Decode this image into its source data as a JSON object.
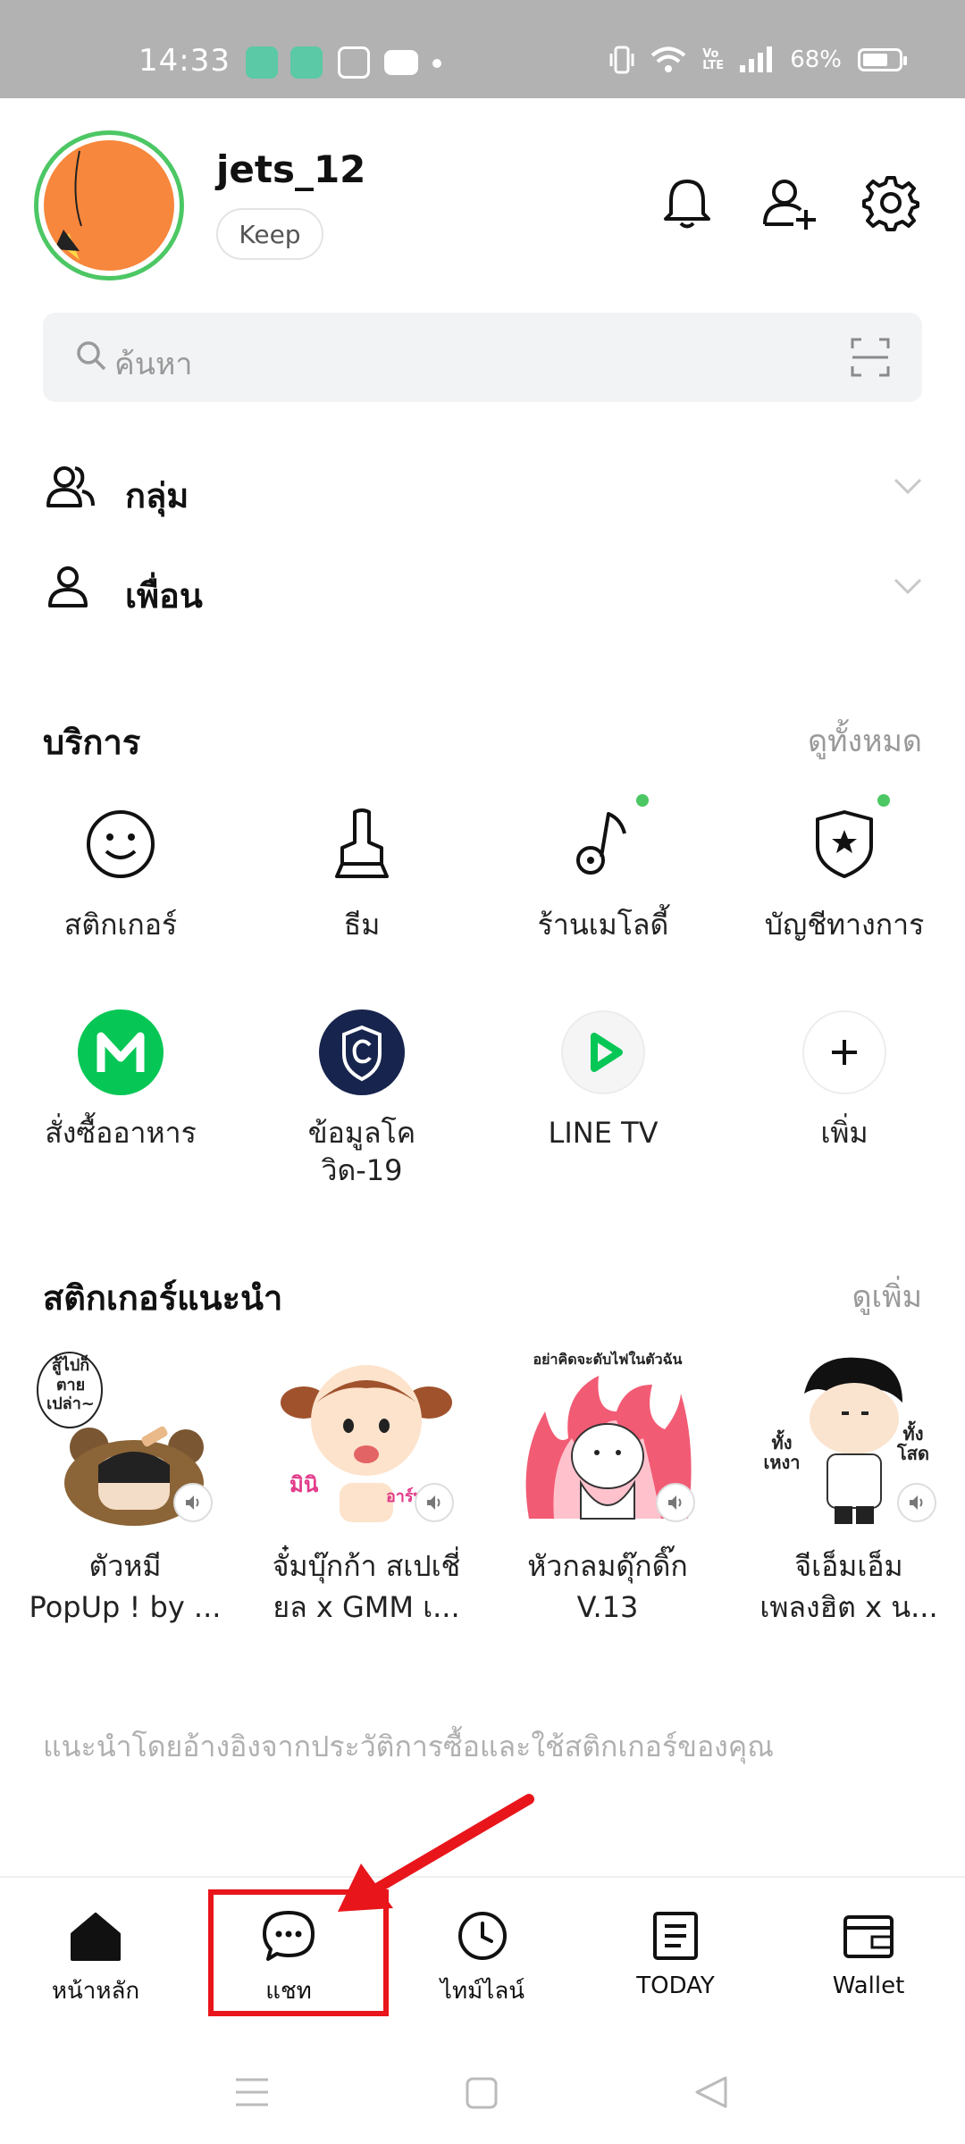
{
  "status_bar": {
    "time": "14:33",
    "battery": "68%",
    "network_badge": "Vo LTE"
  },
  "profile": {
    "name": "jets_12",
    "keep_label": "Keep"
  },
  "search": {
    "placeholder": "ค้นหา"
  },
  "lists": {
    "groups_label": "กลุ่ม",
    "friends_label": "เพื่อน"
  },
  "services": {
    "title": "บริการ",
    "see_all": "ดูทั้งหมด",
    "items": [
      {
        "label": "สติกเกอร์",
        "icon": "sticker-smile-icon"
      },
      {
        "label": "ธีม",
        "icon": "theme-brush-icon"
      },
      {
        "label": "ร้านเมโลดี้",
        "icon": "melody-note-icon"
      },
      {
        "label": "บัญชีทางการ",
        "icon": "official-shield-icon"
      },
      {
        "label": "สั่งซื้ออาหาร",
        "icon": "lineman-icon"
      },
      {
        "label": "ข้อมูลโควิด-19",
        "icon": "covid-shield-icon"
      },
      {
        "label": "LINE TV",
        "icon": "play-icon"
      },
      {
        "label": "เพิ่ม",
        "icon": "plus-icon"
      }
    ]
  },
  "stickers": {
    "title": "สติกเกอร์แนะนำ",
    "see_more": "ดูเพิ่ม",
    "art_text": [
      "สู้ไปก็ตายเปล่า~",
      "มินิ",
      "อาร์ท",
      "อย่าคิดจะดับไฟในตัวฉัน",
      "ทั้งเหงา",
      "ทั้งโสด"
    ],
    "items": [
      {
        "line1": "ตัวหมี",
        "line2": "PopUp ! by ..."
      },
      {
        "line1": "จั๋มบุ๊กก้า สเปเชี่",
        "line2": "ยล x GMM เ..."
      },
      {
        "line1": "หัวกลมดุ๊กดิ๊ก",
        "line2": "V.13"
      },
      {
        "line1": "จีเอ็มเอ็ม",
        "line2": "เพลงฮิต x น..."
      }
    ],
    "note": "แนะนำโดยอ้างอิงจากประวัติการซื้อและใช้สติกเกอร์ของคุณ"
  },
  "bottom_nav": {
    "tabs": [
      {
        "label": "หน้าหลัก",
        "icon": "home-icon"
      },
      {
        "label": "แชท",
        "icon": "chat-bubble-icon"
      },
      {
        "label": "ไทม์ไลน์",
        "icon": "clock-icon"
      },
      {
        "label": "TODAY",
        "icon": "news-icon"
      },
      {
        "label": "Wallet",
        "icon": "wallet-icon"
      }
    ]
  },
  "colors": {
    "line_green": "#4cc764",
    "annotation_red": "#e8151b",
    "avatar_orange": "#f7873c"
  }
}
